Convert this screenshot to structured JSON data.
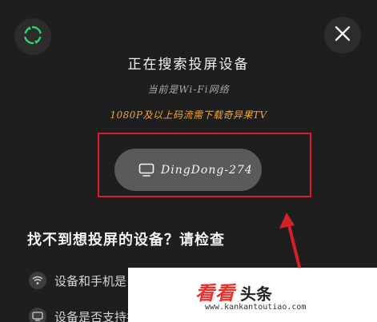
{
  "colors": {
    "background": "#1e1e1f",
    "refresh_accent": "#2bd46e",
    "promo": "#f0a53a",
    "pill": "#5a5a5b",
    "annotation_red": "#d3202a",
    "watermark_brand": "#e8322b"
  },
  "header": {
    "refresh_icon": "refresh-icon",
    "close_icon": "close-icon"
  },
  "status": {
    "title": "正在搜索投屏设备",
    "subtitle": "当前是Wi-Fi网络",
    "promo": "1080P及以上码流需下载奇异果TV"
  },
  "device": {
    "icon": "tv-icon",
    "name": "DingDong-274"
  },
  "help": {
    "title": "找不到想投屏的设备？请检查",
    "items": [
      {
        "icon": "wifi-icon",
        "text": "设备和手机是"
      },
      {
        "icon": "tv-icon",
        "text": "设备是否支持投屏？"
      }
    ]
  },
  "watermark": {
    "brand": "看看",
    "suffix": "头条",
    "url": "www.kankantoutiao.com"
  }
}
